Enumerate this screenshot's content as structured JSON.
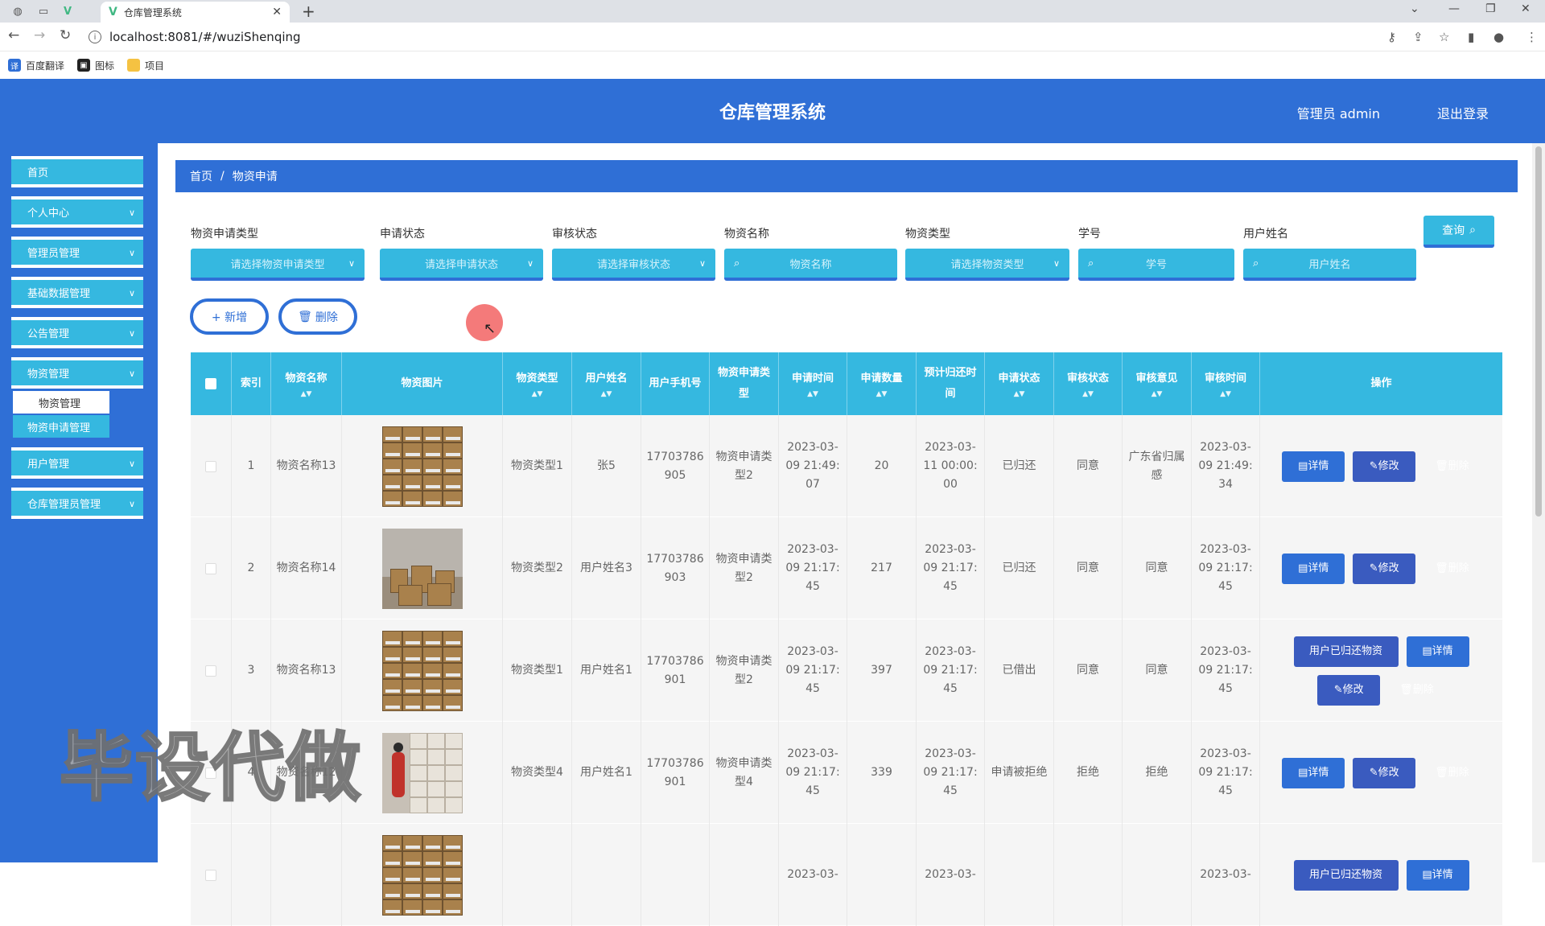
{
  "browser": {
    "tab_title": "仓库管理系统",
    "url": "localhost:8081/#/wuziShenqing",
    "bookmarks": [
      {
        "label": "百度翻译",
        "color": "#2f6fd6"
      },
      {
        "label": "图标",
        "color": "#222222"
      },
      {
        "label": "项目",
        "color": "#f5c242"
      }
    ]
  },
  "header": {
    "title": "仓库管理系统",
    "admin": "管理员 admin",
    "logout": "退出登录"
  },
  "sidebar": {
    "items": [
      {
        "label": "首页"
      },
      {
        "label": "个人中心"
      },
      {
        "label": "管理员管理"
      },
      {
        "label": "基础数据管理"
      },
      {
        "label": "公告管理"
      },
      {
        "label": "物资管理"
      },
      {
        "label": "用户管理"
      },
      {
        "label": "仓库管理员管理"
      }
    ],
    "submenu": [
      "物资管理",
      "物资申请管理"
    ]
  },
  "breadcrumb": {
    "home": "首页",
    "sep": "/",
    "current": "物资申请"
  },
  "filters": {
    "fields": [
      {
        "label": "物资申请类型",
        "placeholder": "请选择物资申请类型"
      },
      {
        "label": "申请状态",
        "placeholder": "请选择申请状态"
      },
      {
        "label": "审核状态",
        "placeholder": "请选择审核状态"
      },
      {
        "label": "物资名称",
        "placeholder": "物资名称"
      },
      {
        "label": "物资类型",
        "placeholder": "请选择物资类型"
      },
      {
        "label": "学号",
        "placeholder": "学号"
      },
      {
        "label": "用户姓名",
        "placeholder": "用户姓名"
      }
    ],
    "query": "查询"
  },
  "actions": {
    "add": "+ 新增",
    "delete": "删除"
  },
  "table": {
    "headers": [
      "索引",
      "物资名称",
      "物资图片",
      "物资类型",
      "用户姓名",
      "用户手机号",
      "物资申请类型",
      "申请时间",
      "申请数量",
      "预计归还时间",
      "申请状态",
      "审核状态",
      "审核意见",
      "审核时间",
      "操作"
    ],
    "rows": [
      {
        "idx": "1",
        "name": "物资名称13",
        "type": "物资类型1",
        "user": "张5",
        "phone": "17703786905",
        "apply_type": "物资申请类型2",
        "apply_time": "2023-03-09 21:49:07",
        "qty": "20",
        "return_time": "2023-03-11 00:00:00",
        "apply_status": "已归还",
        "audit_status": "同意",
        "audit_opinion": "广东省归属感",
        "audit_time": "2023-03-09 21:49:34"
      },
      {
        "idx": "2",
        "name": "物资名称14",
        "type": "物资类型2",
        "user": "用户姓名3",
        "phone": "17703786903",
        "apply_type": "物资申请类型2",
        "apply_time": "2023-03-09 21:17:45",
        "qty": "217",
        "return_time": "2023-03-09 21:17:45",
        "apply_status": "已归还",
        "audit_status": "同意",
        "audit_opinion": "同意",
        "audit_time": "2023-03-09 21:17:45"
      },
      {
        "idx": "3",
        "name": "物资名称13",
        "type": "物资类型1",
        "user": "用户姓名1",
        "phone": "17703786901",
        "apply_type": "物资申请类型2",
        "apply_time": "2023-03-09 21:17:45",
        "qty": "397",
        "return_time": "2023-03-09 21:17:45",
        "apply_status": "已借出",
        "audit_status": "同意",
        "audit_opinion": "同意",
        "audit_time": "2023-03-09 21:17:45"
      },
      {
        "idx": "4",
        "name": "物资名称12",
        "type": "物资类型4",
        "user": "用户姓名1",
        "phone": "17703786901",
        "apply_type": "物资申请类型4",
        "apply_time": "2023-03-09 21:17:45",
        "qty": "339",
        "return_time": "2023-03-09 21:17:45",
        "apply_status": "申请被拒绝",
        "audit_status": "拒绝",
        "audit_opinion": "拒绝",
        "audit_time": "2023-03-09 21:17:45"
      },
      {
        "idx": "",
        "name": "",
        "type": "",
        "user": "",
        "phone": "",
        "apply_type": "",
        "apply_time": "2023-03-",
        "qty": "",
        "return_time": "2023-03-",
        "apply_status": "",
        "audit_status": "",
        "audit_opinion": "",
        "audit_time": "2023-03-"
      }
    ],
    "op_labels": {
      "detail": "详情",
      "edit": "修改",
      "delete": "删除",
      "return": "用户已归还物资"
    }
  },
  "watermark": "毕设代做"
}
